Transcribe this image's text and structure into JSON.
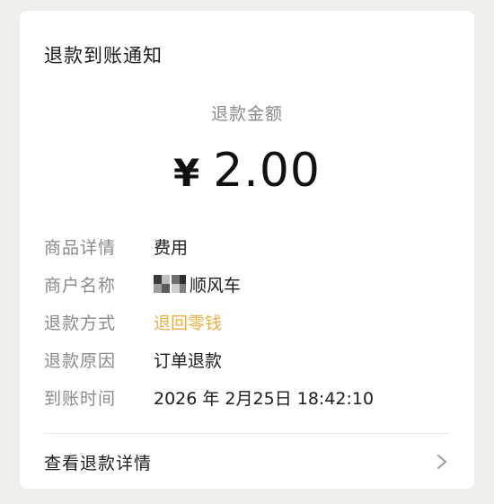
{
  "card": {
    "title": "退款到账通知",
    "amount_label": "退款金额",
    "currency_symbol": "¥",
    "amount": "2.00"
  },
  "details": [
    {
      "key": "商品详情",
      "value": "费用"
    },
    {
      "key": "商户名称",
      "value": "顺风车",
      "redacted_prefix": true
    },
    {
      "key": "退款方式",
      "value": "退回零钱",
      "accent": "#e8b04b"
    },
    {
      "key": "退款原因",
      "value": "订单退款"
    },
    {
      "key": "到账时间",
      "value": "2026 年 2月25日 18:42:10"
    }
  ],
  "footer": {
    "label": "查看退款详情",
    "icon": "chevron-right-icon"
  },
  "colors": {
    "background": "#f0eeeb",
    "card": "#ffffff",
    "accent": "#e8b04b",
    "muted": "#8a8a8a",
    "text": "#1c1c1c"
  }
}
